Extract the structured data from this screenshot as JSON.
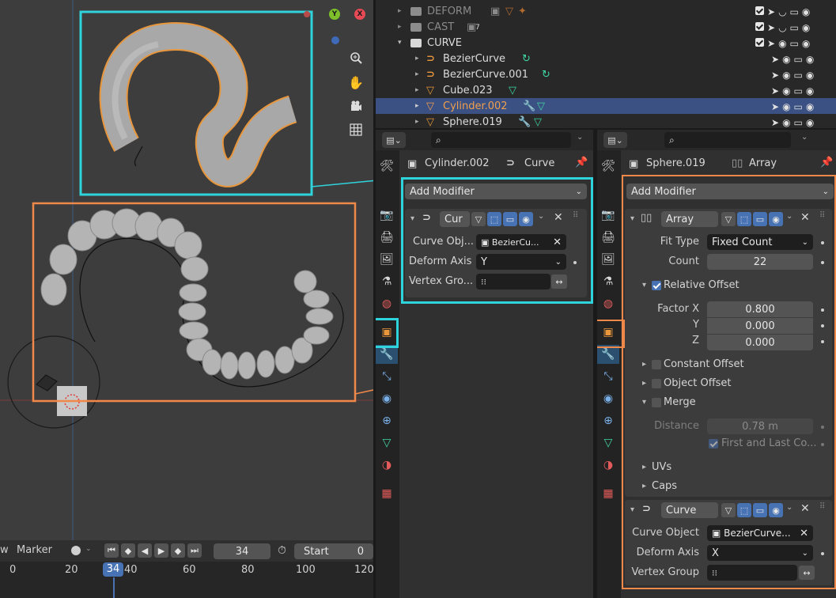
{
  "viewport": {
    "gizmo": {
      "y": "Y",
      "x": "X"
    },
    "nav_icons": [
      "zoom-icon",
      "hand-pan-icon",
      "camera-icon",
      "grid-view-icon"
    ]
  },
  "timeline": {
    "view_label": "w",
    "marker_label": "Marker",
    "current_frame": "34",
    "start_label": "Start",
    "start_value": "0",
    "ruler": [
      "0",
      "20",
      "34",
      "40",
      "60",
      "80",
      "100",
      "120"
    ]
  },
  "outliner": {
    "collections": [
      {
        "label": "DEFORM",
        "muted": true
      },
      {
        "label": "CAST",
        "muted": true,
        "badge": "7"
      },
      {
        "label": "CURVE",
        "muted": false
      }
    ],
    "objects": [
      {
        "label": "BezierCurve",
        "type": "curve"
      },
      {
        "label": "BezierCurve.001",
        "type": "curve"
      },
      {
        "label": "Cube.023",
        "type": "mesh"
      },
      {
        "label": "Cylinder.002",
        "type": "mesh",
        "selected": true
      },
      {
        "label": "Sphere.019",
        "type": "mesh"
      }
    ]
  },
  "left_props": {
    "search_placeholder": "",
    "object_name": "Cylinder.002",
    "data_name": "Curve",
    "add_modifier": "Add Modifier",
    "modifier": {
      "name": "Cur",
      "curve_object_label": "Curve Obj...",
      "curve_object_value": "BezierCu...",
      "deform_axis_label": "Deform Axis",
      "deform_axis_value": "Y",
      "vertex_group_label": "Vertex Gro..."
    }
  },
  "right_props": {
    "search_placeholder": "",
    "object_name": "Sphere.019",
    "data_name": "Array",
    "add_modifier": "Add Modifier",
    "array": {
      "name": "Array",
      "fit_type_label": "Fit Type",
      "fit_type_value": "Fixed Count",
      "count_label": "Count",
      "count_value": "22",
      "relative_offset_label": "Relative Offset",
      "factor_x_label": "Factor X",
      "factor_x": "0.800",
      "y_label": "Y",
      "factor_y": "0.000",
      "z_label": "Z",
      "factor_z": "0.000",
      "constant_offset_label": "Constant Offset",
      "object_offset_label": "Object Offset",
      "merge_label": "Merge",
      "distance_label": "Distance",
      "distance_value": "0.78 m",
      "first_last_label": "First and Last Co...",
      "uvs_label": "UVs",
      "caps_label": "Caps"
    },
    "curve": {
      "name": "Curve",
      "curve_object_label": "Curve Object",
      "curve_object_value": "BezierCurve...",
      "deform_axis_label": "Deform Axis",
      "deform_axis_value": "X",
      "vertex_group_label": "Vertex Group"
    }
  },
  "colors": {
    "cyan_highlight": "#2fd3dc",
    "orange_highlight": "#f0884a",
    "selected_row": "#3b5083",
    "object_orange": "#e8963c",
    "mesh_green": "#3fd7a2",
    "frame_blue": "#4772b3"
  }
}
